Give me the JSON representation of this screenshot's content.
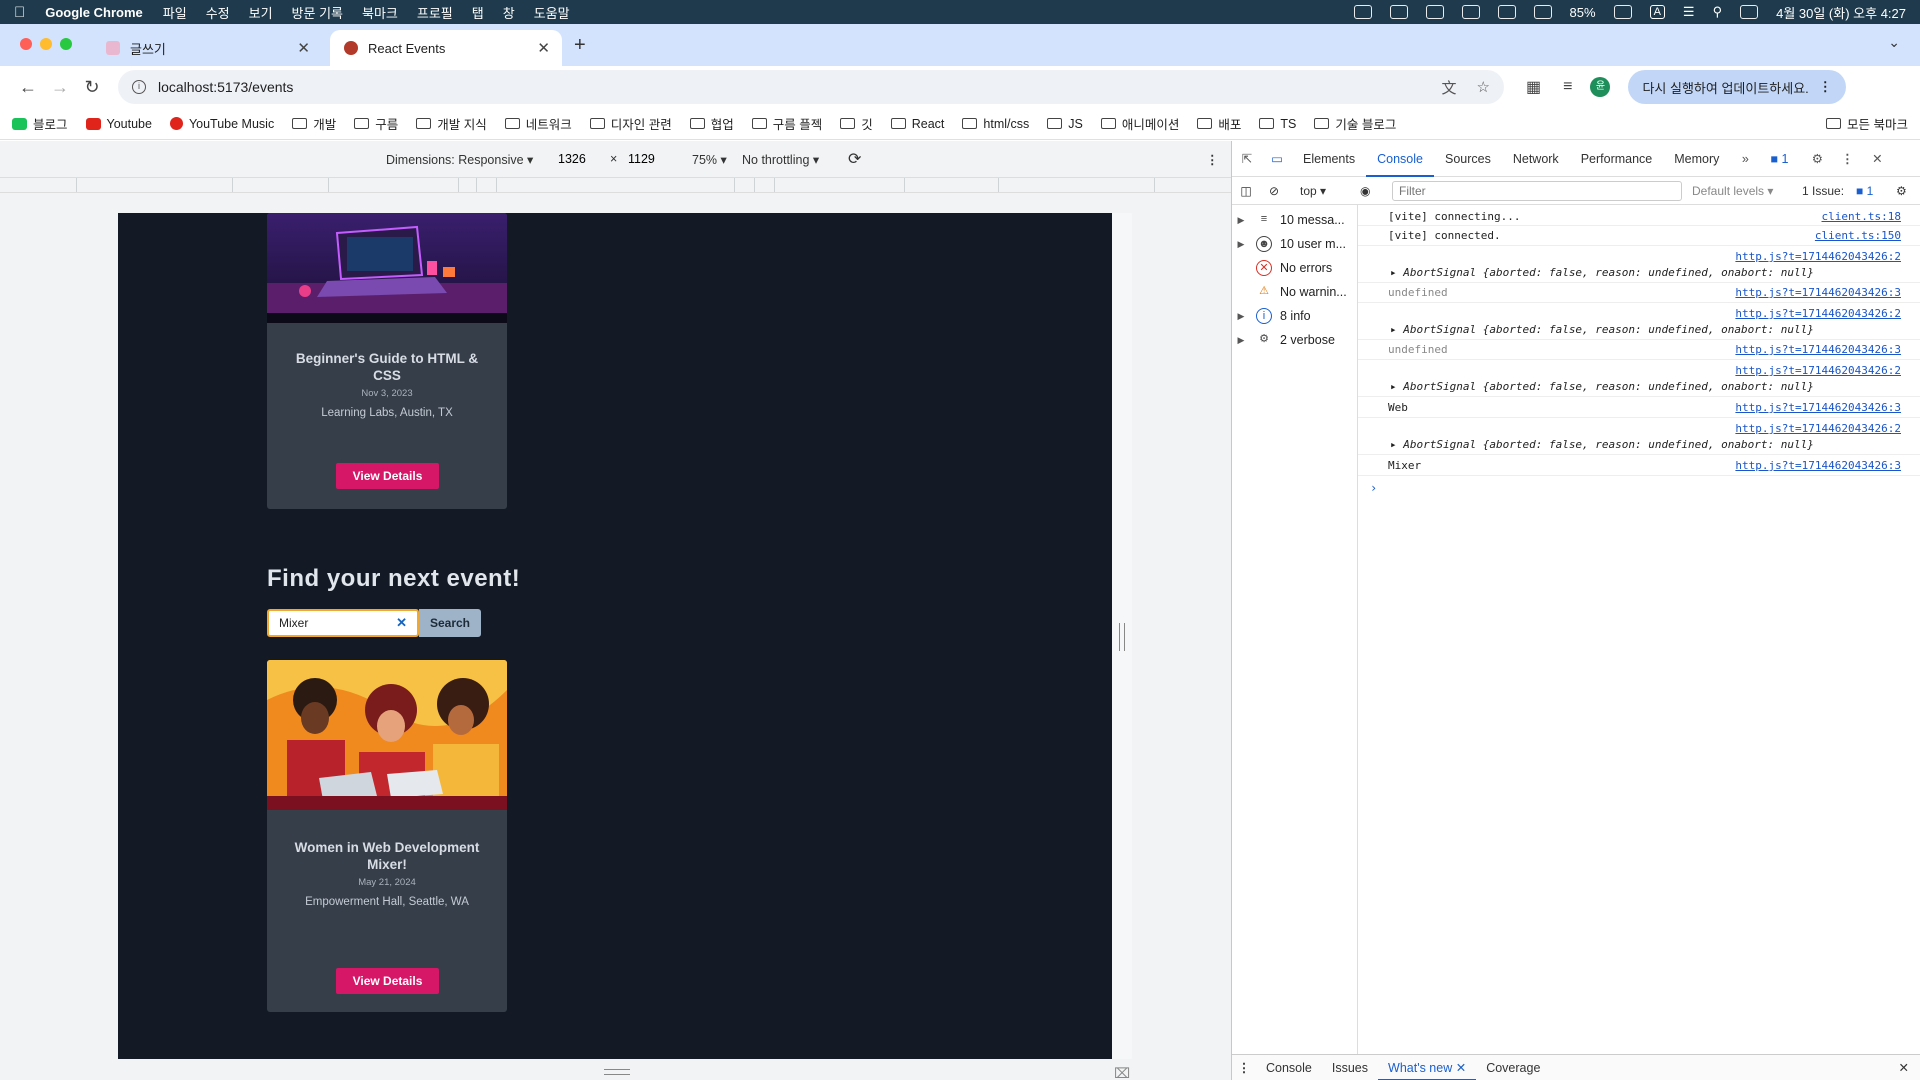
{
  "menubar": {
    "app": "Google Chrome",
    "items": [
      "파일",
      "수정",
      "보기",
      "방문 기록",
      "북마크",
      "프로필",
      "탭",
      "창",
      "도움말"
    ],
    "battery": "85%",
    "clock": "4월 30일 (화) 오후 4:27"
  },
  "tabs": [
    {
      "title": "글쓰기"
    },
    {
      "title": "React Events"
    }
  ],
  "toolbar": {
    "url": "localhost:5173/events",
    "update_label": "다시 실행하여 업데이트하세요.",
    "profile_initial": "윤"
  },
  "bookmarks": [
    "블로그",
    "Youtube",
    "YouTube Music",
    "개발",
    "구름",
    "개발 지식",
    "네트워크",
    "디자인 관련",
    "협업",
    "구름 플젝",
    "깃",
    "React",
    "html/css",
    "JS",
    "애니메이션",
    "배포",
    "TS",
    "기술 블로그"
  ],
  "bookmarks_all": "모든 북마크",
  "device_toolbar": {
    "dimensions": "Dimensions: Responsive",
    "width": "1326",
    "times": "×",
    "height": "1129",
    "zoom": "75%",
    "throttling": "No throttling"
  },
  "page": {
    "card1": {
      "title": "Beginner's Guide to HTML & CSS",
      "date": "Nov 3, 2023",
      "location": "Learning Labs, Austin, TX",
      "button": "View Details"
    },
    "find_title": "Find your next event!",
    "search_value": "Mixer",
    "search_button": "Search",
    "card2": {
      "title": "Women in Web Development Mixer!",
      "date": "May 21, 2024",
      "location": "Empowerment Hall, Seattle, WA",
      "button": "View Details"
    }
  },
  "devtools": {
    "tabs": [
      "Elements",
      "Console",
      "Sources",
      "Network",
      "Performance",
      "Memory"
    ],
    "active_tab": "Console",
    "issues_badge": "1",
    "context": "top",
    "filter_placeholder": "Filter",
    "levels": "Default levels",
    "issues_label": "1 Issue:",
    "issues_count": "1",
    "sidebar": [
      {
        "label": "10 messa...",
        "icon": "list-icon"
      },
      {
        "label": "10 user m...",
        "icon": "user-icon"
      },
      {
        "label": "No errors",
        "icon": "error-icon"
      },
      {
        "label": "No warnin...",
        "icon": "warning-icon"
      },
      {
        "label": "8 info",
        "icon": "info-icon"
      },
      {
        "label": "2 verbose",
        "icon": "bug-icon"
      }
    ],
    "logs": [
      {
        "msg": "[vite] connecting...",
        "src": "client.ts:18"
      },
      {
        "msg": "[vite] connected.",
        "src": "client.ts:150"
      },
      {
        "msg": "AbortSignal {aborted: false, reason: undefined, onabort: null}",
        "src": "http.js?t=1714462043426:2"
      },
      {
        "msg": "undefined",
        "src": "http.js?t=1714462043426:3"
      },
      {
        "msg": "AbortSignal {aborted: false, reason: undefined, onabort: null}",
        "src": "http.js?t=1714462043426:2"
      },
      {
        "msg": "undefined",
        "src": "http.js?t=1714462043426:3"
      },
      {
        "msg": "AbortSignal {aborted: false, reason: undefined, onabort: null}",
        "src": "http.js?t=1714462043426:2"
      },
      {
        "msg": "Web",
        "src": "http.js?t=1714462043426:3"
      },
      {
        "msg": "AbortSignal {aborted: false, reason: undefined, onabort: null}",
        "src": "http.js?t=1714462043426:2"
      },
      {
        "msg": "Mixer",
        "src": "http.js?t=1714462043426:3"
      }
    ],
    "drawer_tabs": [
      "Console",
      "Issues",
      "What's new",
      "Coverage"
    ]
  },
  "colors": {
    "accent": "#d61667",
    "page_bg": "#131a25",
    "card_bg": "#363e4a",
    "devtools_blue": "#1a5fd0"
  }
}
